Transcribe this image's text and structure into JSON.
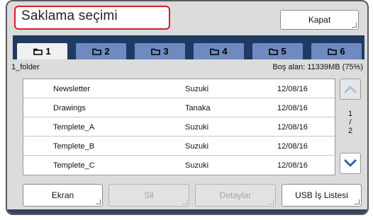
{
  "title": "Saklama seçimi",
  "close_label": "Kapat",
  "tabs": [
    {
      "label": "1",
      "active": true
    },
    {
      "label": "2",
      "active": false
    },
    {
      "label": "3",
      "active": false
    },
    {
      "label": "4",
      "active": false
    },
    {
      "label": "5",
      "active": false
    },
    {
      "label": "6",
      "active": false
    }
  ],
  "folder_name": "1_folder",
  "free_space": "Boş alan: 11339MB (75%)",
  "rows": [
    {
      "name": "Newsletter",
      "owner": "Suzuki",
      "date": "12/08/16"
    },
    {
      "name": "Drawings",
      "owner": "Tanaka",
      "date": "12/08/16"
    },
    {
      "name": "Templete_A",
      "owner": "Suzuki",
      "date": "12/08/16"
    },
    {
      "name": "Templete_B",
      "owner": "Suzuki",
      "date": "12/08/16"
    },
    {
      "name": "Templete_C",
      "owner": "Suzuki",
      "date": "12/08/16"
    }
  ],
  "page": {
    "current": "1",
    "sep": "/",
    "total": "2"
  },
  "buttons": {
    "ekran": "Ekran",
    "sil": "Sil",
    "detaylar": "Detaylar",
    "usb": "USB İş Listesi"
  },
  "colors": {
    "accent_red": "#d81e27",
    "tabbar_navy": "#1f3b63",
    "tab_blue": "#6f8ac0",
    "arrow_blue": "#2e5faa"
  },
  "icons": {
    "tab": "folder-icon",
    "scroll_up": "chevron-up-icon",
    "scroll_down": "chevron-down-icon"
  }
}
